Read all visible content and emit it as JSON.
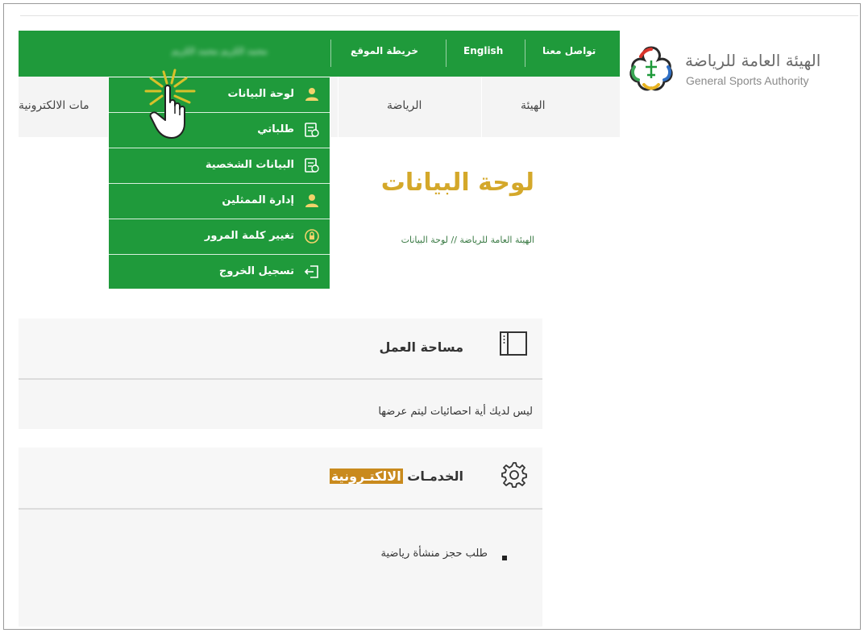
{
  "header": {
    "top_links": {
      "contact": "تواصل معنا",
      "english": "English",
      "sitemap": "خريطة الموقع",
      "user_name": "محمد الكريم محمد الكريم"
    },
    "logo": {
      "arabic": "الهيئة العامة للرياضة",
      "english": "General Sports Authority"
    },
    "nav": [
      "الهيئة",
      "الرياضة",
      "مات الالكترونية"
    ]
  },
  "dropdown": {
    "items": [
      {
        "label": "لوحة البيانات",
        "icon": "user-icon"
      },
      {
        "label": "طلباتي",
        "icon": "requests-icon"
      },
      {
        "label": "البيانات الشخصية",
        "icon": "profile-card-icon"
      },
      {
        "label": "إدارة الممثلين",
        "icon": "user-icon"
      },
      {
        "label": "تغيير كلمة المرور",
        "icon": "lock-icon"
      },
      {
        "label": "تسجيل الخروج",
        "icon": "logout-icon"
      }
    ]
  },
  "page": {
    "title": "لوحة البيانات",
    "breadcrumb": "الهيئة العامة للرياضة // لوحة البيانات"
  },
  "workspace": {
    "title": "مساحة العمل",
    "message": "ليس لديك أية احصائيات ليتم عرضها"
  },
  "eservices": {
    "title_part1": "الخدمـات ",
    "title_highlight": "الالكتـرونية",
    "items": [
      "طلب حجز منشأة رياضية"
    ]
  },
  "colors": {
    "brand_green": "#1f9a3b",
    "title_gold": "#d4a82a",
    "highlight": "#c98a1d"
  }
}
